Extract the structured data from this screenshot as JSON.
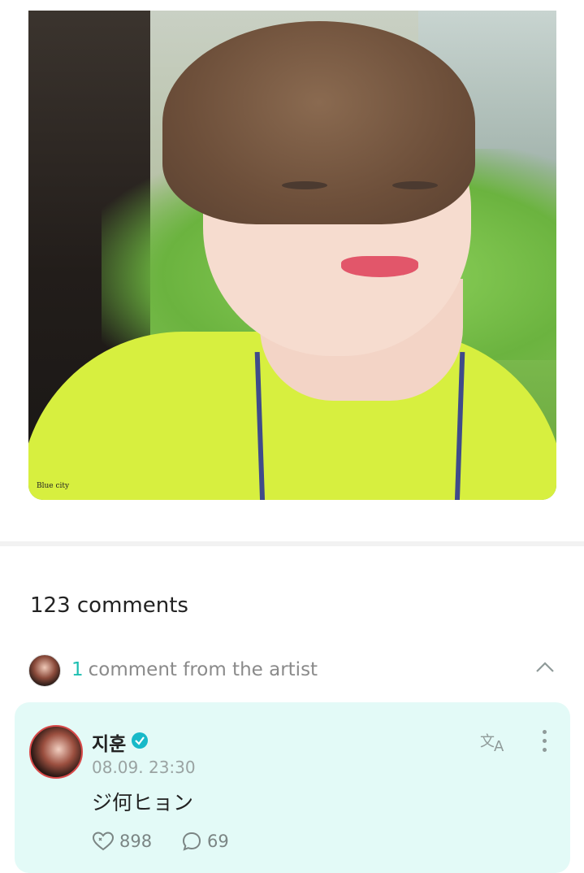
{
  "post": {
    "photo_watermark": "Blue city"
  },
  "comments": {
    "count_label": "123 comments",
    "artist_summary": {
      "count": "1",
      "label": "comment from the artist"
    },
    "artist_comment": {
      "author": "지훈",
      "timestamp": "08.09. 23:30",
      "text": "ジ何ヒョン",
      "likes": "898",
      "replies": "69"
    }
  },
  "icons": {
    "verified": "verified-check-icon",
    "translate": "translate-icon",
    "more": "more-vertical-icon",
    "like": "heart-like-icon",
    "reply": "comment-bubble-icon",
    "collapse": "chevron-up-icon"
  },
  "colors": {
    "accent": "#1dbfb1",
    "card_bg": "#e3faf7",
    "verified": "#17b9c8"
  }
}
